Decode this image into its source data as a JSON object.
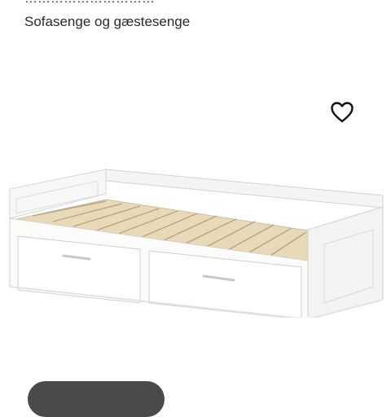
{
  "header": {
    "partial_title": "…………………………",
    "category": "Sofasenge og gæstesenge"
  },
  "actions": {
    "favorite_icon": "heart-outline-icon"
  },
  "product": {
    "image_subject": "daybed"
  },
  "colors": {
    "background": "#ffffff",
    "text": "#2a2a2a",
    "button_dark": "#4a4a4a"
  }
}
